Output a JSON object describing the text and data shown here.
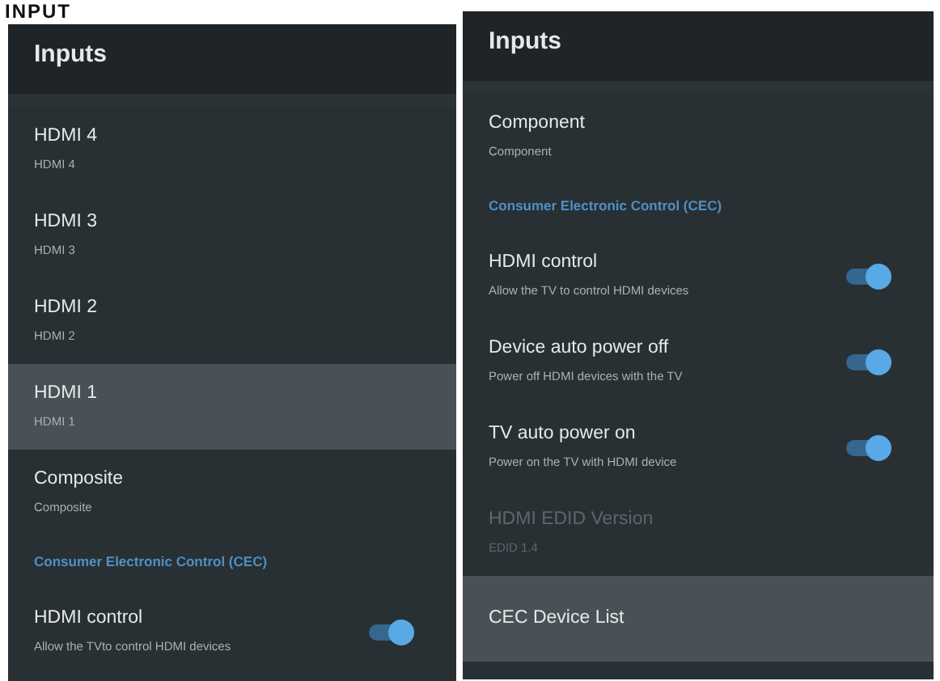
{
  "page_heading": "INPUT",
  "panels": [
    {
      "title": "Inputs",
      "items": [
        {
          "kind": "input",
          "title": "HDMI 4",
          "subtitle": "HDMI 4",
          "selected": false,
          "disabled": false
        },
        {
          "kind": "input",
          "title": "HDMI 3",
          "subtitle": "HDMI 3",
          "selected": false,
          "disabled": false
        },
        {
          "kind": "input",
          "title": "HDMI 2",
          "subtitle": "HDMI 2",
          "selected": false,
          "disabled": false
        },
        {
          "kind": "input",
          "title": "HDMI 1",
          "subtitle": "HDMI 1",
          "selected": true,
          "disabled": false
        },
        {
          "kind": "input",
          "title": "Composite",
          "subtitle": "Composite",
          "selected": false,
          "disabled": false
        },
        {
          "kind": "section",
          "title": "Consumer Electronic Control (CEC)"
        },
        {
          "kind": "toggle",
          "title": "HDMI control",
          "subtitle": "Allow the TVto control HDMI devices",
          "on": true,
          "selected": false,
          "disabled": false
        }
      ]
    },
    {
      "title": "Inputs",
      "items": [
        {
          "kind": "input",
          "title": "Component",
          "subtitle": "Component",
          "selected": false,
          "disabled": false
        },
        {
          "kind": "section",
          "title": "Consumer Electronic Control (CEC)"
        },
        {
          "kind": "toggle",
          "title": "HDMI control",
          "subtitle": "Allow the TV to control HDMI devices",
          "on": true,
          "selected": false,
          "disabled": false
        },
        {
          "kind": "toggle",
          "title": "Device auto power off",
          "subtitle": "Power off HDMI devices with the TV",
          "on": true,
          "selected": false,
          "disabled": false
        },
        {
          "kind": "toggle",
          "title": "TV auto power on",
          "subtitle": "Power on the TV with HDMI device",
          "on": true,
          "selected": false,
          "disabled": false
        },
        {
          "kind": "input",
          "title": "HDMI EDID Version",
          "subtitle": "EDID 1.4",
          "selected": false,
          "disabled": true
        },
        {
          "kind": "input",
          "title": "CEC Device List",
          "selected": true,
          "disabled": false
        }
      ]
    }
  ]
}
